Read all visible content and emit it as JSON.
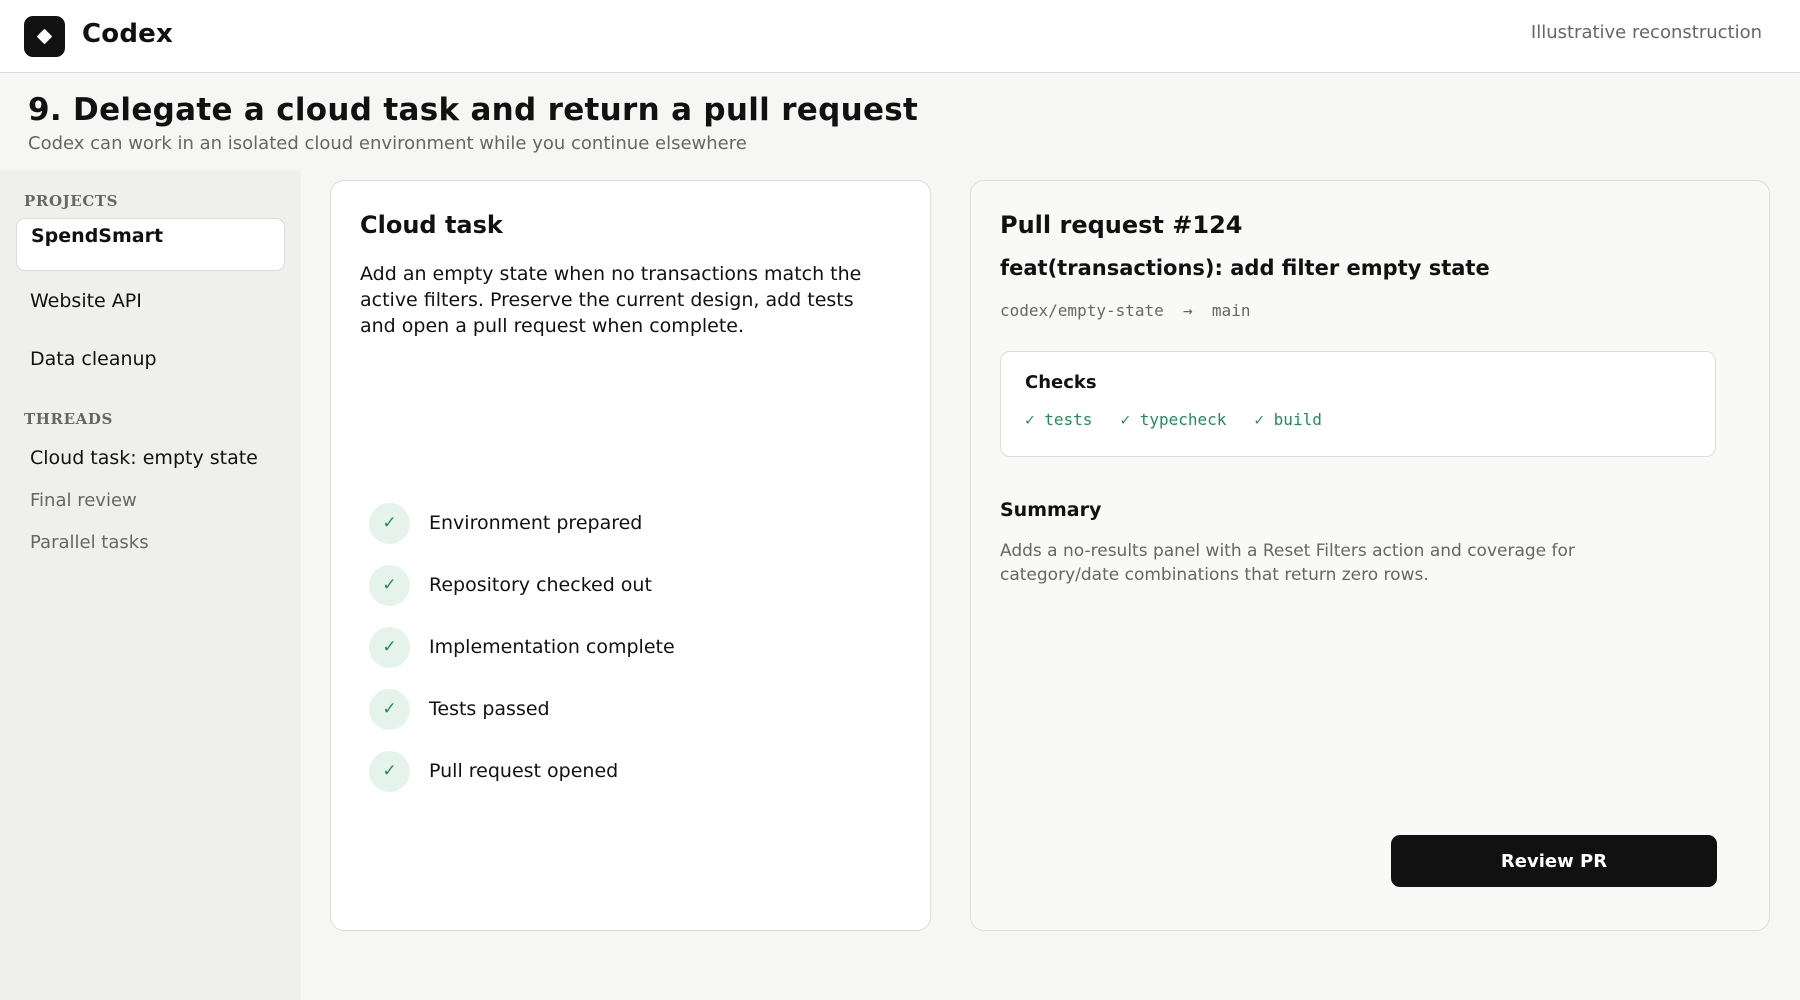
{
  "header": {
    "brand": "Codex",
    "tagline": "Illustrative reconstruction",
    "logo_icon": "diamond-icon"
  },
  "page": {
    "title": "9. Delegate a cloud task and return a pull request",
    "subtitle": "Codex can work in an isolated cloud environment while you continue elsewhere"
  },
  "sidebar": {
    "projects_label": "PROJECTS",
    "projects": [
      {
        "label": "SpendSmart",
        "active": true
      },
      {
        "label": "Website API"
      },
      {
        "label": "Data cleanup"
      }
    ],
    "threads_label": "THREADS",
    "threads": [
      {
        "label": "Cloud task: empty state"
      },
      {
        "label": "Final review"
      },
      {
        "label": "Parallel tasks"
      }
    ]
  },
  "task": {
    "title": "Cloud task",
    "description": "Add an empty state when no transactions match the active filters. Preserve the current design, add tests and open a pull request when complete.",
    "steps": [
      {
        "label": "Environment prepared",
        "mark": "✓"
      },
      {
        "label": "Repository checked out",
        "mark": "✓"
      },
      {
        "label": "Implementation complete",
        "mark": "✓"
      },
      {
        "label": "Tests passed",
        "mark": "✓"
      },
      {
        "label": "Pull request opened",
        "mark": "✓"
      }
    ]
  },
  "pull_request": {
    "title": "Pull request #124",
    "commit_title": "feat(transactions): add filter empty state",
    "branch": "codex/empty-state  →  main",
    "checks_title": "Checks",
    "checks": [
      "✓ tests",
      "✓ typecheck",
      "✓ build"
    ],
    "summary_title": "Summary",
    "summary_text": "Adds a no-results panel with a Reset Filters action and coverage for category/date combinations that return zero rows.",
    "review_button": "Review PR"
  },
  "colors": {
    "accent_green": "#1f8f58",
    "check_bg": "#e6f3ec",
    "dark": "#111111"
  }
}
